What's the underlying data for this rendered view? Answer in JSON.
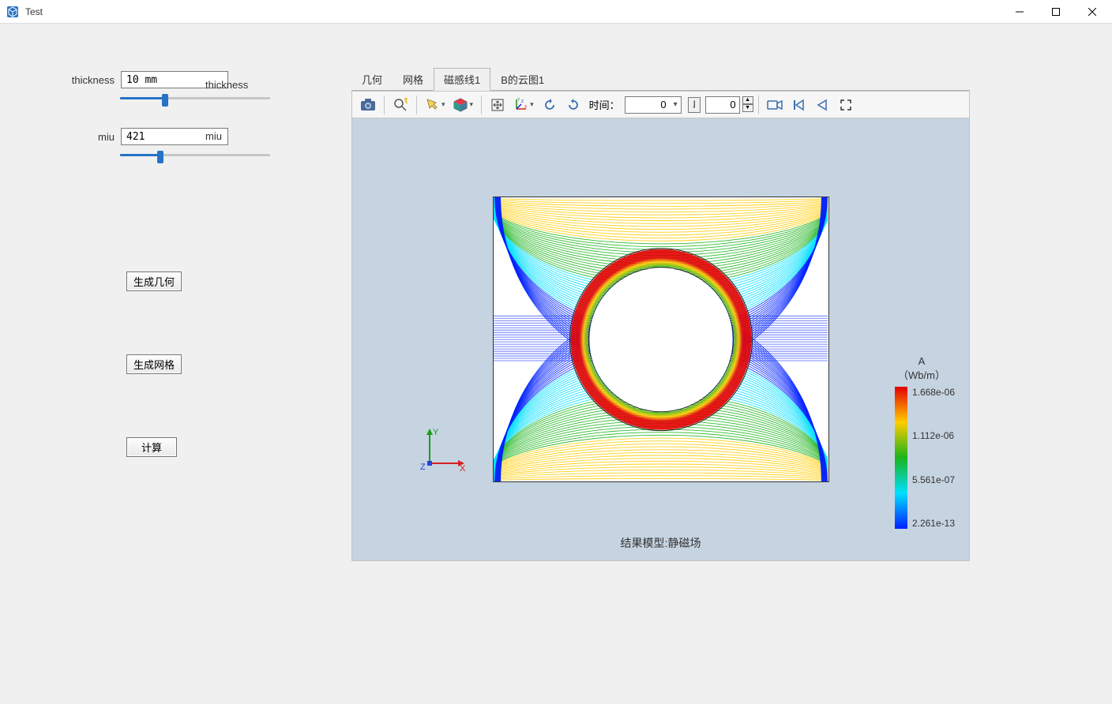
{
  "window": {
    "title": "Test"
  },
  "params": {
    "thickness": {
      "label": "thickness",
      "mid_label": "thickness",
      "value": "10 mm",
      "slider_pct": 30
    },
    "miu": {
      "label": "miu",
      "mid_label": "miu",
      "value": "421",
      "slider_pct": 27
    }
  },
  "buttons": {
    "gen_geometry": "生成几何",
    "gen_mesh": "生成网格",
    "compute": "计算"
  },
  "tabs": {
    "items": [
      "几何",
      "网格",
      "磁感线1",
      "B的云图1"
    ],
    "active_index": 2
  },
  "toolbar": {
    "time_label": "时间：",
    "time_value": "0",
    "frame_value": "0"
  },
  "viz": {
    "footer": "结果模型:静磁场",
    "axes": {
      "x": "X",
      "y": "Y",
      "z": "Z"
    }
  },
  "legend": {
    "title_line1": "A",
    "title_line2": "（Wb/m）",
    "ticks": [
      "1.668e-06",
      "1.112e-06",
      "5.561e-07",
      "2.261e-13"
    ]
  }
}
